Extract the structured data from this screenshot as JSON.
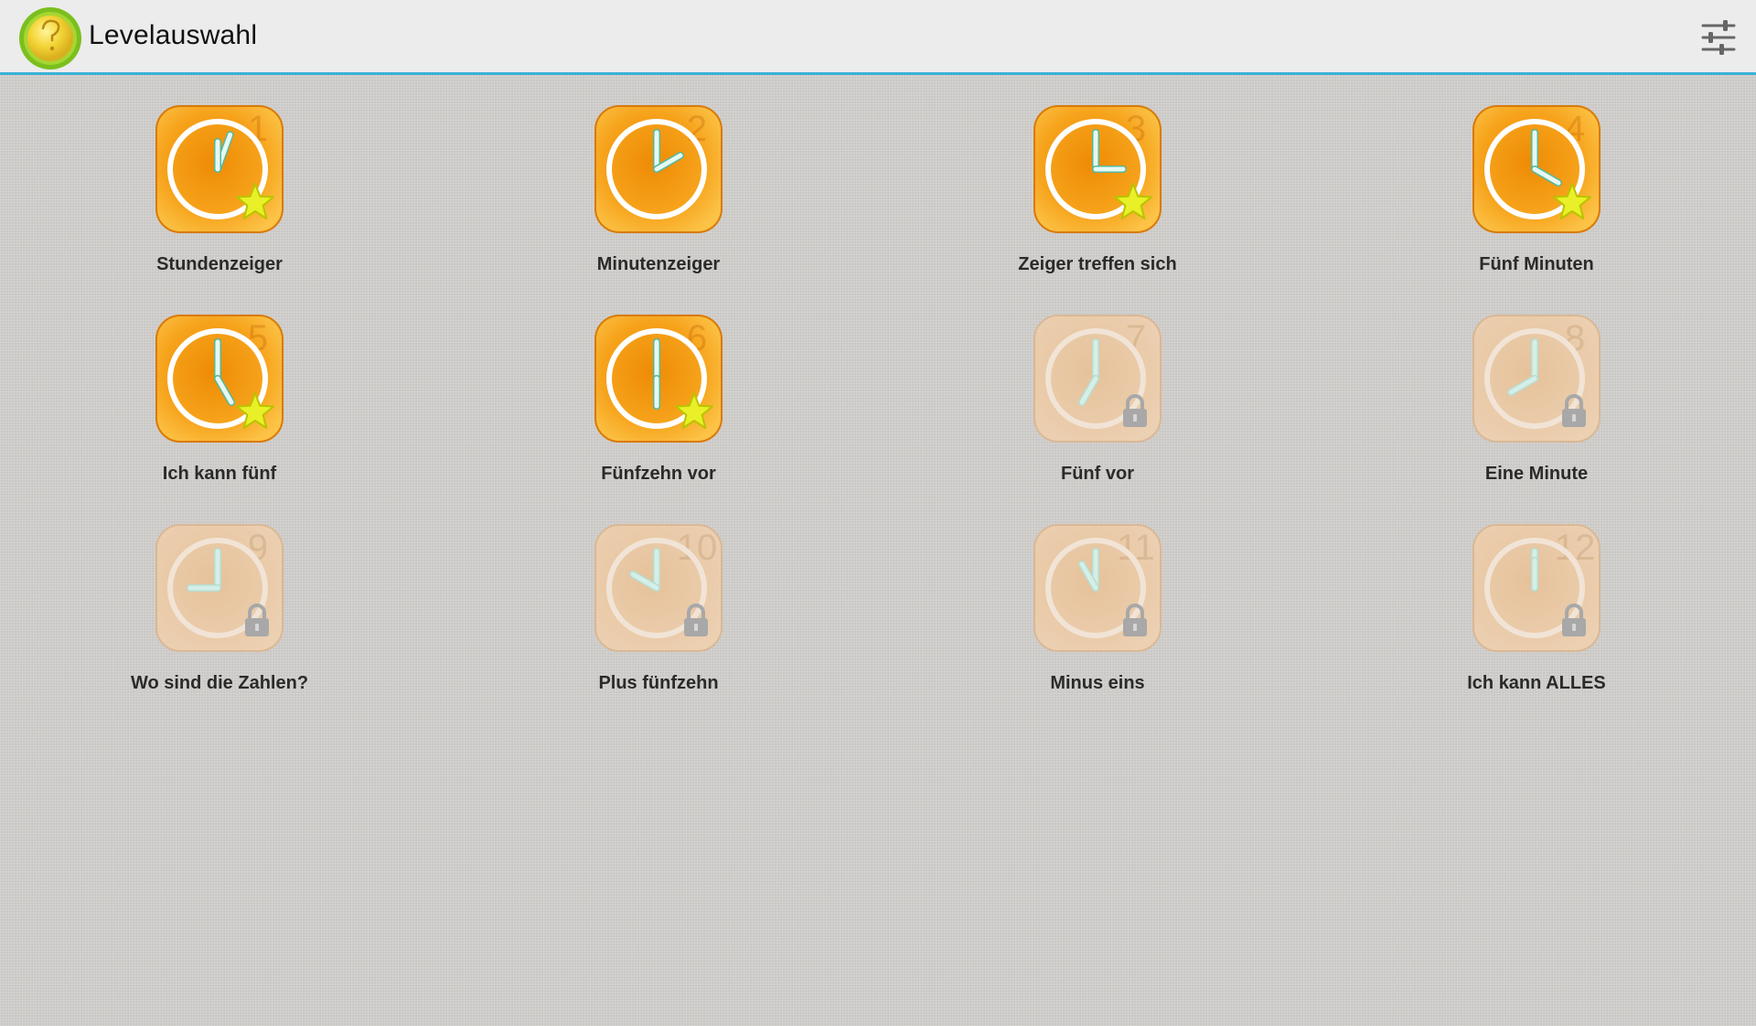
{
  "appbar": {
    "title": "Levelauswahl",
    "logo_icon": "question-clock-logo",
    "settings_icon": "sliders-icon",
    "accent": "#3bb0d6"
  },
  "colors": {
    "unlocked_tile": "#f59a12",
    "locked_tile": "#e7c7a3",
    "hand": "#dff5ef",
    "star": "#eaf027"
  },
  "levels": [
    {
      "number": "1",
      "label": "Stundenzeiger",
      "status": "completed",
      "hour_deg": 20,
      "minute_deg": 0
    },
    {
      "number": "2",
      "label": "Minutenzeiger",
      "status": "unlocked",
      "hour_deg": 0,
      "minute_deg": 60
    },
    {
      "number": "3",
      "label": "Zeiger treffen sich",
      "status": "completed",
      "hour_deg": 0,
      "minute_deg": 90
    },
    {
      "number": "4",
      "label": "Fünf Minuten",
      "status": "completed",
      "hour_deg": 0,
      "minute_deg": 120
    },
    {
      "number": "5",
      "label": "Ich kann fünf",
      "status": "completed",
      "hour_deg": 0,
      "minute_deg": 150
    },
    {
      "number": "6",
      "label": "Fünfzehn vor",
      "status": "completed",
      "hour_deg": 0,
      "minute_deg": 180
    },
    {
      "number": "7",
      "label": "Fünf vor",
      "status": "locked",
      "hour_deg": 0,
      "minute_deg": 210
    },
    {
      "number": "8",
      "label": "Eine Minute",
      "status": "locked",
      "hour_deg": 0,
      "minute_deg": 240
    },
    {
      "number": "9",
      "label": "Wo sind die Zahlen?",
      "status": "locked",
      "hour_deg": 0,
      "minute_deg": 270
    },
    {
      "number": "10",
      "label": "Plus fünfzehn",
      "status": "locked",
      "hour_deg": 0,
      "minute_deg": 300
    },
    {
      "number": "11",
      "label": "Minus eins",
      "status": "locked",
      "hour_deg": 0,
      "minute_deg": 330
    },
    {
      "number": "12",
      "label": "Ich kann ALLES",
      "status": "locked",
      "hour_deg": 0,
      "minute_deg": 0
    }
  ]
}
